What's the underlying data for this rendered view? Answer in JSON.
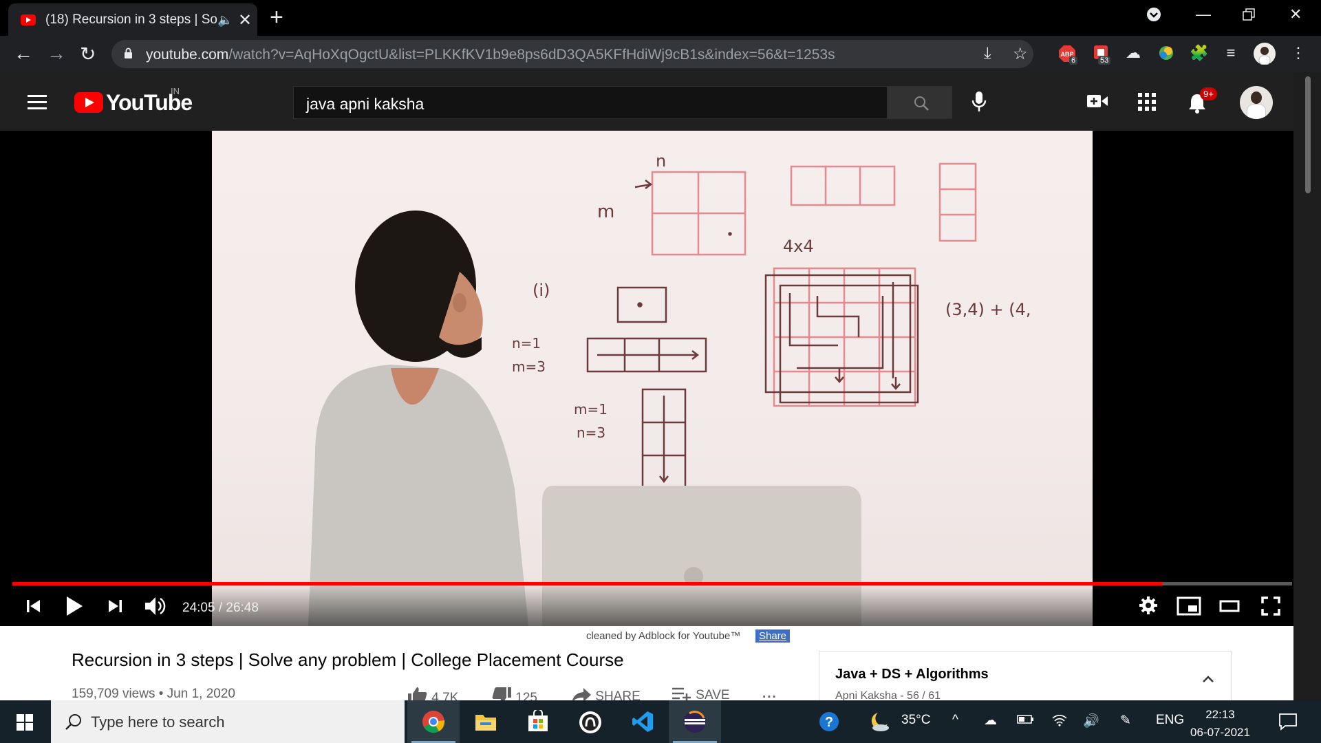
{
  "browser": {
    "tab_title": "(18) Recursion in 3 steps | Sol",
    "url_host": "youtube.com",
    "url_path": "/watch?v=AqHoXqOgctU&list=PLKKfKV1b9e8ps6dD3QA5KFfHdiWj9cB1s&index=56&t=1253s",
    "ext_abp_count": "6",
    "ext_notes_count": "53"
  },
  "youtube": {
    "logo_text": "YouTube",
    "country": "IN",
    "search_query": "java apni kaksha",
    "notifications": "9+"
  },
  "player": {
    "time_display": "24:05 / 26:48",
    "progress_fraction": 0.8986
  },
  "video": {
    "adblock_note": "cleaned by Adblock for Youtube™",
    "adblock_share": "Share",
    "title": "Recursion in 3 steps | Solve any problem | College Placement Course",
    "meta": "159,709 views • Jun 1, 2020",
    "likes": "4.7K",
    "dislikes": "125",
    "share_label": "SHARE",
    "save_label": "SAVE",
    "more_label": "..."
  },
  "playlist": {
    "title": "Java + DS + Algorithms",
    "subtitle": "Apni Kaksha - 56 / 61"
  },
  "board": {
    "n_top": "n",
    "m_left": "m",
    "size_label": "4x4",
    "case_label": "(i)",
    "n1": "n=1",
    "m3": "m=3",
    "m1": "m=1",
    "n3": "n=3",
    "sum_expr": "(3,4) + (4,"
  },
  "taskbar": {
    "search_placeholder": "Type here to search",
    "temperature": "35°C",
    "language": "ENG",
    "time": "22:13",
    "date": "06-07-2021"
  }
}
